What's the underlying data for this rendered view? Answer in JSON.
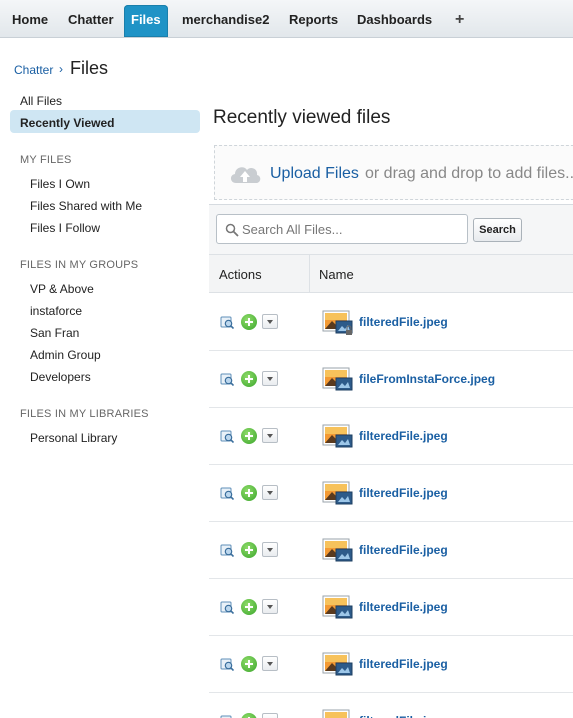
{
  "tabs": [
    {
      "label": "Home"
    },
    {
      "label": "Chatter"
    },
    {
      "label": "Files",
      "active": true
    },
    {
      "label": "merchandise2"
    },
    {
      "label": "Reports"
    },
    {
      "label": "Dashboards"
    },
    {
      "label": "+"
    }
  ],
  "breadcrumb": {
    "parent": "Chatter",
    "separator": "›",
    "title": "Files"
  },
  "sidebar": {
    "top_items": [
      "All Files",
      "Recently Viewed"
    ],
    "active_item": "Recently Viewed",
    "my_files": {
      "heading": "MY FILES",
      "items": [
        "Files I Own",
        "Files Shared with Me",
        "Files I Follow"
      ]
    },
    "groups": {
      "heading": "FILES IN MY GROUPS",
      "items": [
        "VP & Above",
        "instaforce",
        "San Fran",
        "Admin Group",
        "Developers"
      ]
    },
    "libraries": {
      "heading": "FILES IN MY LIBRARIES",
      "items": [
        "Personal Library"
      ]
    }
  },
  "main": {
    "title": "Recently viewed files",
    "upload": {
      "link": "Upload Files",
      "hint": "or drag and drop to add files..."
    },
    "search": {
      "placeholder": "Search All Files...",
      "value": "",
      "button": "Search"
    },
    "columns": {
      "actions": "Actions",
      "name": "Name"
    },
    "rows": [
      {
        "name": "filteredFile.jpeg",
        "locked": true
      },
      {
        "name": "fileFromInstaForce.jpeg"
      },
      {
        "name": "filteredFile.jpeg"
      },
      {
        "name": "filteredFile.jpeg"
      },
      {
        "name": "filteredFile.jpeg"
      },
      {
        "name": "filteredFile.jpeg"
      },
      {
        "name": "filteredFile.jpeg"
      },
      {
        "name": "filteredFile.jpeg"
      }
    ]
  },
  "colors": {
    "accent": "#1f93c6",
    "link": "#1a5fa3",
    "active_bg": "#cfe6f3"
  },
  "icons": {
    "upload": "cloud-upload-icon",
    "search": "magnifier-icon",
    "preview": "preview-icon",
    "follow": "plus-circle-icon",
    "menu": "dropdown-caret-icon",
    "file": "image-file-icon"
  }
}
